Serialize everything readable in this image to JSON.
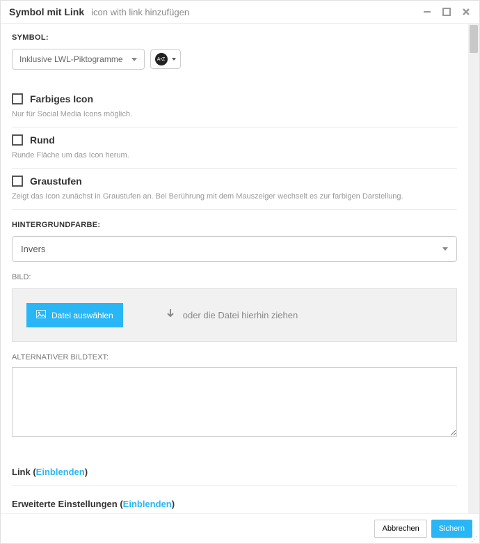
{
  "titlebar": {
    "title": "Symbol mit Link",
    "subtitle": "icon with link hinzufügen"
  },
  "symbol": {
    "label": "SYMBOL:",
    "dropdown_value": "Inklusive LWL-Piktogramme",
    "sort_chip": "A•Z"
  },
  "options": [
    {
      "label": "Farbiges Icon",
      "hint": "Nur für Social Media Icons möglich."
    },
    {
      "label": "Rund",
      "hint": "Runde Fläche um das Icon herum."
    },
    {
      "label": "Graustufen",
      "hint": "Zeigt das Icon zunächst in Graustufen an. Bei Berührung mit dem Mauszeiger wechselt es zur farbigen Darstellung."
    }
  ],
  "bgcolor": {
    "label": "HINTERGRUNDFARBE:",
    "value": "Invers"
  },
  "image": {
    "label": "BILD:",
    "button": "Datei auswählen",
    "hint": "oder die Datei hierhin ziehen"
  },
  "alttext": {
    "label": "ALTERNATIVER BILDTEXT:"
  },
  "link_section": {
    "prefix": "Link (",
    "toggle": "Einblenden",
    "suffix": ")"
  },
  "advanced_section": {
    "prefix": "Erweiterte Einstellungen (",
    "toggle": "Einblenden",
    "suffix": ")"
  },
  "footer": {
    "cancel": "Abbrechen",
    "save": "Sichern"
  }
}
